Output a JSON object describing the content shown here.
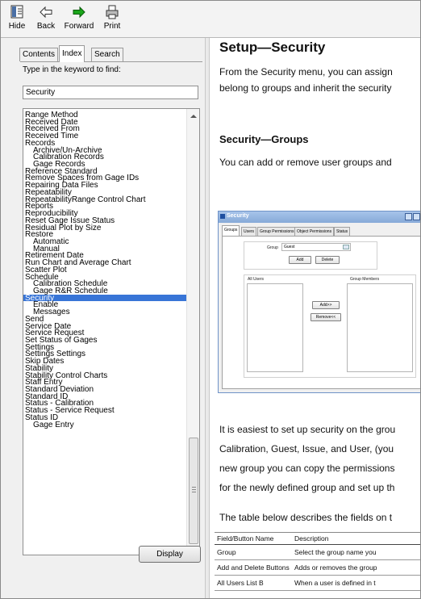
{
  "toolbar": {
    "hide_label": "Hide",
    "back_label": "Back",
    "forward_label": "Forward",
    "print_label": "Print"
  },
  "nav": {
    "tabs": [
      {
        "label": "Contents"
      },
      {
        "label": "Index"
      },
      {
        "label": "Search"
      }
    ],
    "keyword_label": "Type in the keyword to find:",
    "keyword_value": "Security",
    "display_label": "Display",
    "index_items": [
      {
        "label": "Range Method"
      },
      {
        "label": "Received Date"
      },
      {
        "label": "Received From"
      },
      {
        "label": "Received Time"
      },
      {
        "label": "Records"
      },
      {
        "label": "Archive/Un-Archive"
      },
      {
        "label": "Calibration Records"
      },
      {
        "label": "Gage Records"
      },
      {
        "label": "Reference Standard"
      },
      {
        "label": "Remove Spaces from Gage IDs"
      },
      {
        "label": "Repairing Data Files"
      },
      {
        "label": "Repeatability"
      },
      {
        "label": "RepeatabilityRange Control Chart"
      },
      {
        "label": "Reports"
      },
      {
        "label": "Reproducibility"
      },
      {
        "label": "Reset Gage Issue Status"
      },
      {
        "label": "Residual Plot by Size"
      },
      {
        "label": "Restore"
      },
      {
        "label": "Automatic"
      },
      {
        "label": "Manual"
      },
      {
        "label": "Retirement Date"
      },
      {
        "label": "Run Chart and Average Chart"
      },
      {
        "label": "Scatter Plot"
      },
      {
        "label": "Schedule"
      },
      {
        "label": "Calibration Schedule"
      },
      {
        "label": "Gage R&R Schedule"
      },
      {
        "label": "Security"
      },
      {
        "label": "Enable"
      },
      {
        "label": "Messages"
      },
      {
        "label": "Send"
      },
      {
        "label": "Service Date"
      },
      {
        "label": "Service Request"
      },
      {
        "label": "Set Status of Gages"
      },
      {
        "label": "Settings"
      },
      {
        "label": "Settings Settings"
      },
      {
        "label": "Skip Dates"
      },
      {
        "label": "Stability"
      },
      {
        "label": "Stability Control Charts"
      },
      {
        "label": "Staff Entry"
      },
      {
        "label": "Standard Deviation"
      },
      {
        "label": "Standard ID"
      },
      {
        "label": "Status - Calibration"
      },
      {
        "label": "Status - Service Request"
      },
      {
        "label": "Status ID"
      },
      {
        "label": "Gage Entry"
      }
    ]
  },
  "content": {
    "title": "Setup—Security",
    "intro_line1": "From the Security menu, you can assign",
    "intro_line2": "belong to groups and inherit the security",
    "groups_heading": "Security—Groups",
    "groups_line": "You can add or remove user groups and",
    "screenshot": {
      "window_title": "Security",
      "tabs": [
        {
          "label": "Groups"
        },
        {
          "label": "Users"
        },
        {
          "label": "Group Permissions"
        },
        {
          "label": "Object Permissions"
        },
        {
          "label": "Status"
        }
      ],
      "group_label": "Group",
      "group_value": "Guest",
      "add_label": "Add",
      "delete_label": "Delete",
      "all_users_label": "All Users",
      "group_members_label": "Group Members",
      "add_member_label": "Add>>",
      "remove_member_label": "Remove<<"
    },
    "body_line1": "It is easiest to set up security on the grou",
    "body_line2": "Calibration, Guest, Issue, and User, (you",
    "body_line3": "new group you can copy the permissions",
    "body_line4": "for the newly defined group and set up th",
    "table_intro": "The table below describes the fields on t",
    "table": {
      "headers": [
        "Field/Button Name",
        "Description"
      ],
      "rows": [
        {
          "name": "Group",
          "desc": "Select the group name you"
        },
        {
          "name": "Add and Delete Buttons",
          "desc": "Adds or removes the group"
        },
        {
          "name": "All Users List B",
          "desc": "When a user is defined in t"
        }
      ]
    }
  },
  "colors": {
    "selection": "#3875d7",
    "forward_arrow": "#1aa61a"
  }
}
